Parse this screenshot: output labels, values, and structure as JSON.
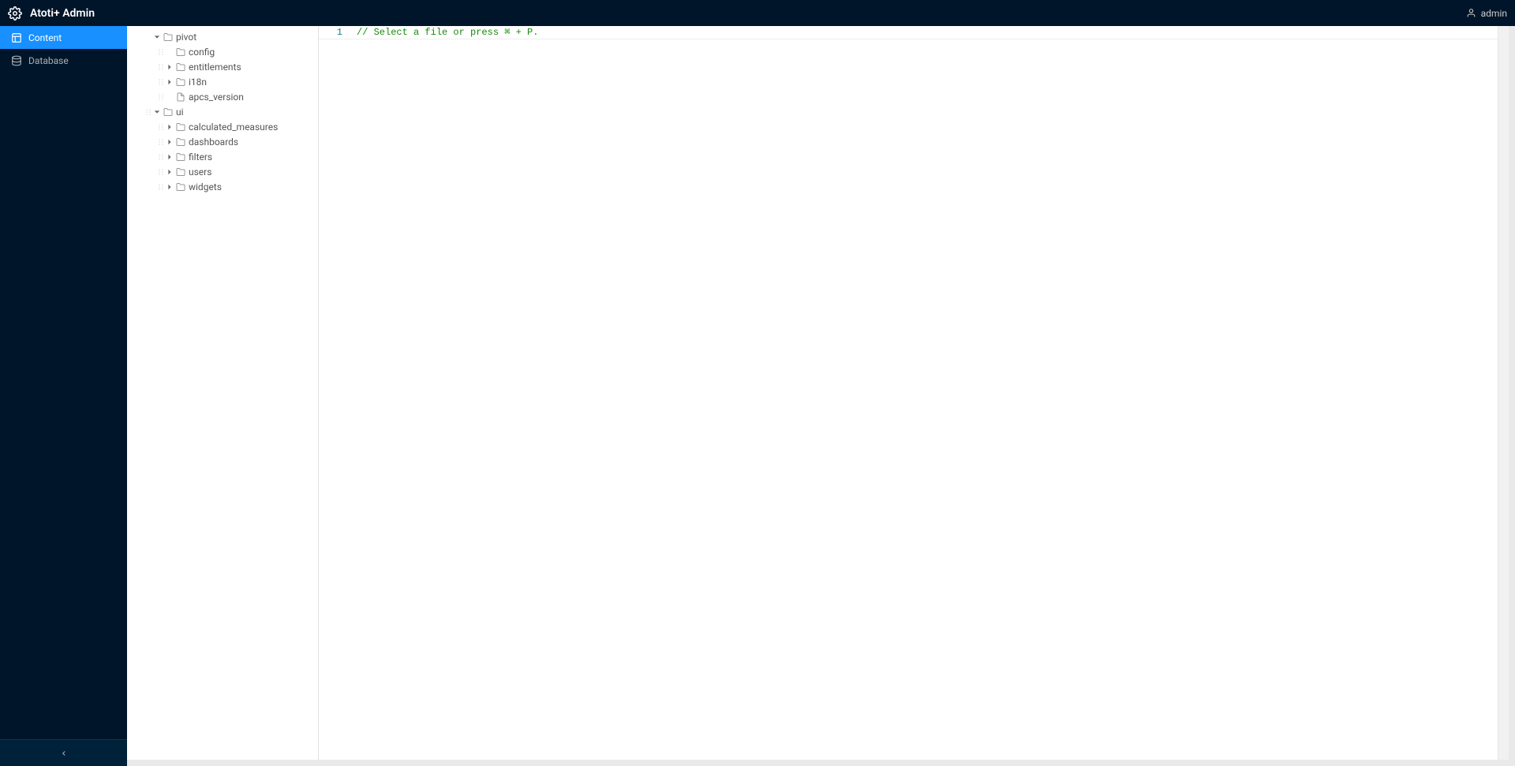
{
  "header": {
    "title": "Atoti+ Admin",
    "user": "admin"
  },
  "sidebar": {
    "items": [
      {
        "label": "Content",
        "icon": "content-icon",
        "active": true
      },
      {
        "label": "Database",
        "icon": "database-icon",
        "active": false
      }
    ],
    "collapse_icon": "chevron-left-icon"
  },
  "tree": [
    {
      "label": "pivot",
      "depth": 0,
      "type": "folder",
      "caret": "down",
      "drag": false
    },
    {
      "label": "config",
      "depth": 1,
      "type": "folder",
      "caret": "none",
      "drag": true
    },
    {
      "label": "entitlements",
      "depth": 1,
      "type": "folder",
      "caret": "right",
      "drag": true
    },
    {
      "label": "i18n",
      "depth": 1,
      "type": "folder",
      "caret": "right",
      "drag": true
    },
    {
      "label": "apcs_version",
      "depth": 1,
      "type": "file",
      "caret": "none",
      "drag": true
    },
    {
      "label": "ui",
      "depth": 0,
      "type": "folder",
      "caret": "down",
      "drag": true
    },
    {
      "label": "calculated_measures",
      "depth": 1,
      "type": "folder",
      "caret": "right",
      "drag": true
    },
    {
      "label": "dashboards",
      "depth": 1,
      "type": "folder",
      "caret": "right",
      "drag": true
    },
    {
      "label": "filters",
      "depth": 1,
      "type": "folder",
      "caret": "right",
      "drag": true
    },
    {
      "label": "users",
      "depth": 1,
      "type": "folder",
      "caret": "right",
      "drag": true
    },
    {
      "label": "widgets",
      "depth": 1,
      "type": "folder",
      "caret": "right",
      "drag": true
    }
  ],
  "editor": {
    "line_number": "1",
    "code": "// Select a file or press ⌘ + P."
  }
}
